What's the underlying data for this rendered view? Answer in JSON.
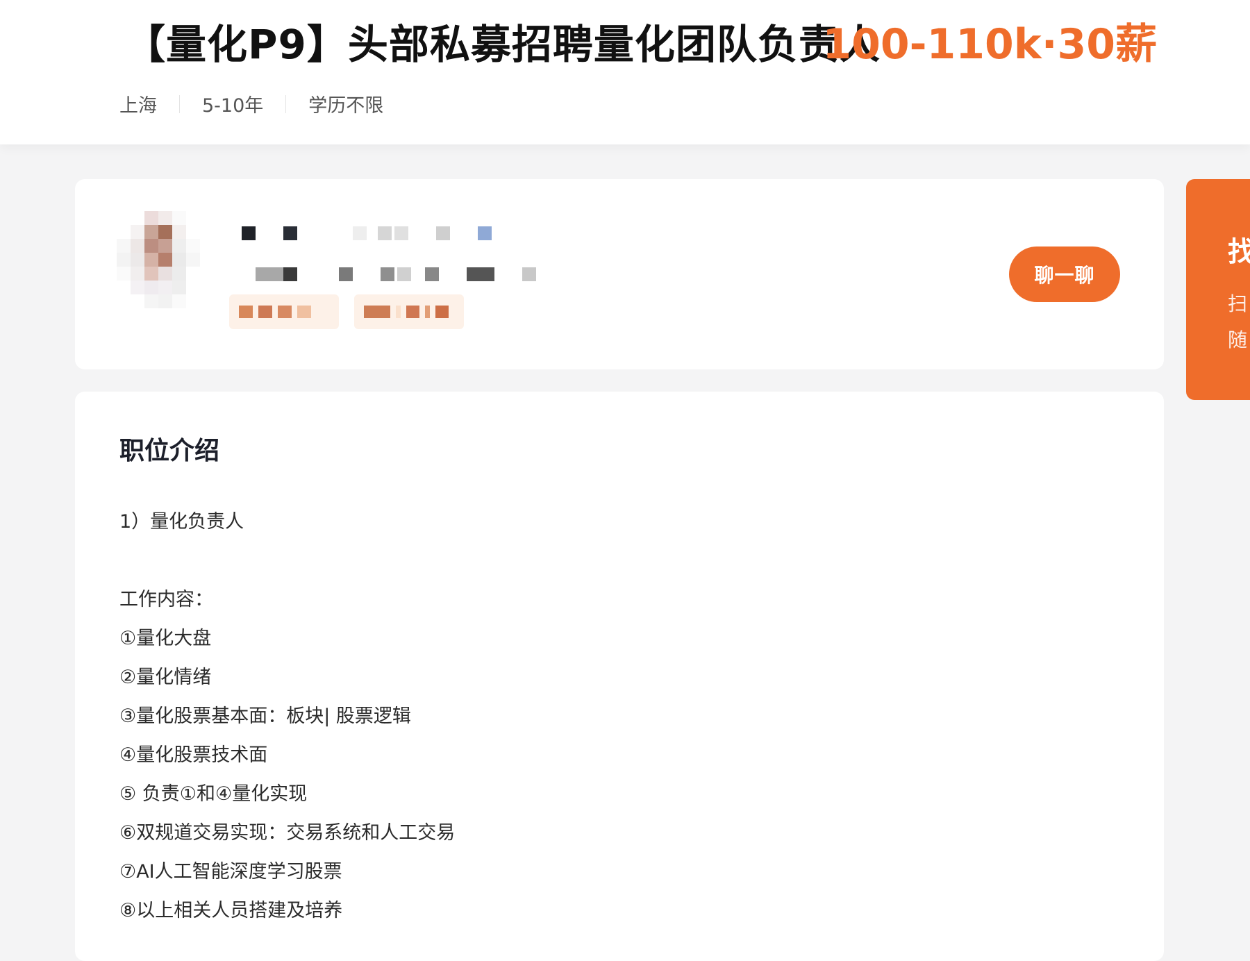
{
  "job": {
    "title": "【量化P9】头部私募招聘量化团队负责人",
    "salary": "100-110k·30薪",
    "meta": [
      "上海",
      "5-10年",
      "学历不限"
    ]
  },
  "recruiter": {
    "chat_label": "聊一聊"
  },
  "side_panel": {
    "title": "找",
    "line1": "扫",
    "line2": "随"
  },
  "description": {
    "heading": "职位介绍",
    "lines": [
      "1）量化负责人",
      "工作内容：",
      "①量化大盘",
      "②量化情绪",
      "③量化股票基本面：板块| 股票逻辑",
      "④量化股票技术面",
      "⑤ 负责①和④量化实现",
      "⑥双规道交易实现：交易系统和人工交易",
      "⑦AI人工智能深度学习股票",
      "⑧以上相关人员搭建及培养"
    ]
  },
  "colors": {
    "accent": "#ef6d2b",
    "title_text": "#111111",
    "page_bg": "#f4f4f5"
  }
}
